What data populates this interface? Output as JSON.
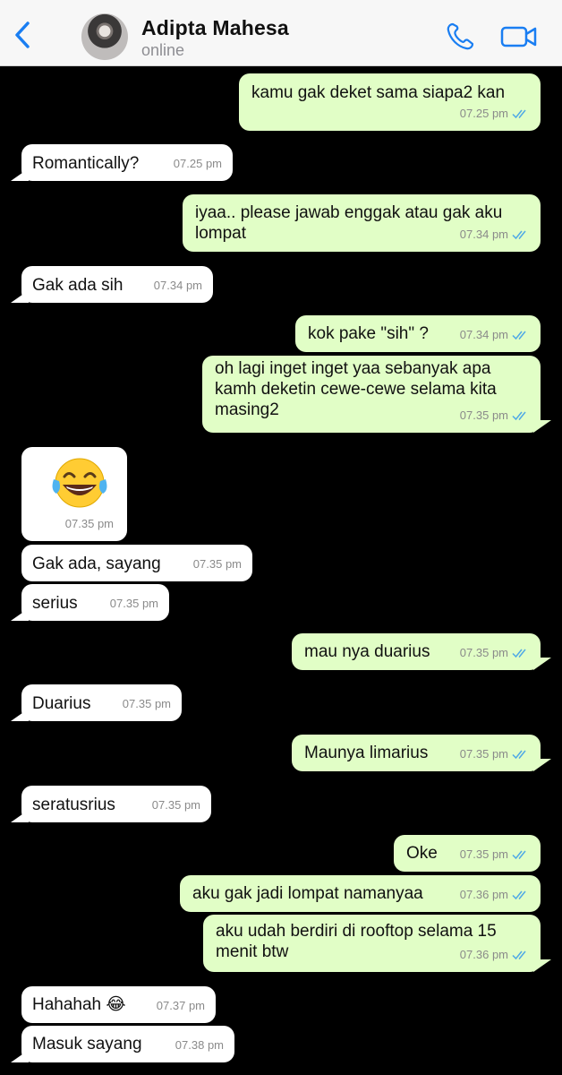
{
  "header": {
    "contact_name": "Adipta Mahesa",
    "status": "online",
    "background": "#f7f7f7",
    "accent": "#1a7ef2"
  },
  "colors": {
    "outgoing_bubble": "#e1fec6",
    "incoming_bubble": "#ffffff",
    "chat_background": "#000000",
    "read_ticks": "#4fa9e6"
  },
  "messages": [
    {
      "direction": "out",
      "text": "kamu gak deket sama siapa2 kan",
      "time": "07.25 pm",
      "read": true
    },
    {
      "direction": "in",
      "text": "Romantically?",
      "time": "07.25 pm"
    },
    {
      "direction": "out",
      "text": "iyaa.. please jawab enggak atau gak aku lompat",
      "time": "07.34 pm",
      "read": true
    },
    {
      "direction": "in",
      "text": "Gak ada sih",
      "time": "07.34 pm"
    },
    {
      "direction": "out",
      "text": "kok pake \"sih\" ?",
      "time": "07.34 pm",
      "read": true
    },
    {
      "direction": "out",
      "text": "oh lagi inget inget yaa sebanyak apa kamh deketin cewe-cewe selama kita masing2",
      "time": "07.35 pm",
      "read": true
    },
    {
      "direction": "in",
      "text": "",
      "emoji": "face-with-tears-of-joy",
      "time": "07.35 pm"
    },
    {
      "direction": "in",
      "text": "Gak ada, sayang",
      "time": "07.35 pm"
    },
    {
      "direction": "in",
      "text": "serius",
      "time": "07.35 pm"
    },
    {
      "direction": "out",
      "text": "mau nya duarius",
      "time": "07.35 pm",
      "read": true
    },
    {
      "direction": "in",
      "text": "Duarius",
      "time": "07.35 pm"
    },
    {
      "direction": "out",
      "text": "Maunya limarius",
      "time": "07.35 pm",
      "read": true
    },
    {
      "direction": "in",
      "text": "seratusrius",
      "time": "07.35 pm"
    },
    {
      "direction": "out",
      "text": "Oke",
      "time": "07.35 pm",
      "read": true
    },
    {
      "direction": "out",
      "text": "aku gak jadi lompat namanyaa",
      "time": "07.36 pm",
      "read": true
    },
    {
      "direction": "out",
      "text": "aku udah berdiri di rooftop selama 15 menit btw",
      "time": "07.36 pm",
      "read": true
    },
    {
      "direction": "in",
      "text": "Hahahah 😂",
      "time": "07.37 pm"
    },
    {
      "direction": "in",
      "text": "Masuk sayang",
      "time": "07.38 pm"
    }
  ]
}
